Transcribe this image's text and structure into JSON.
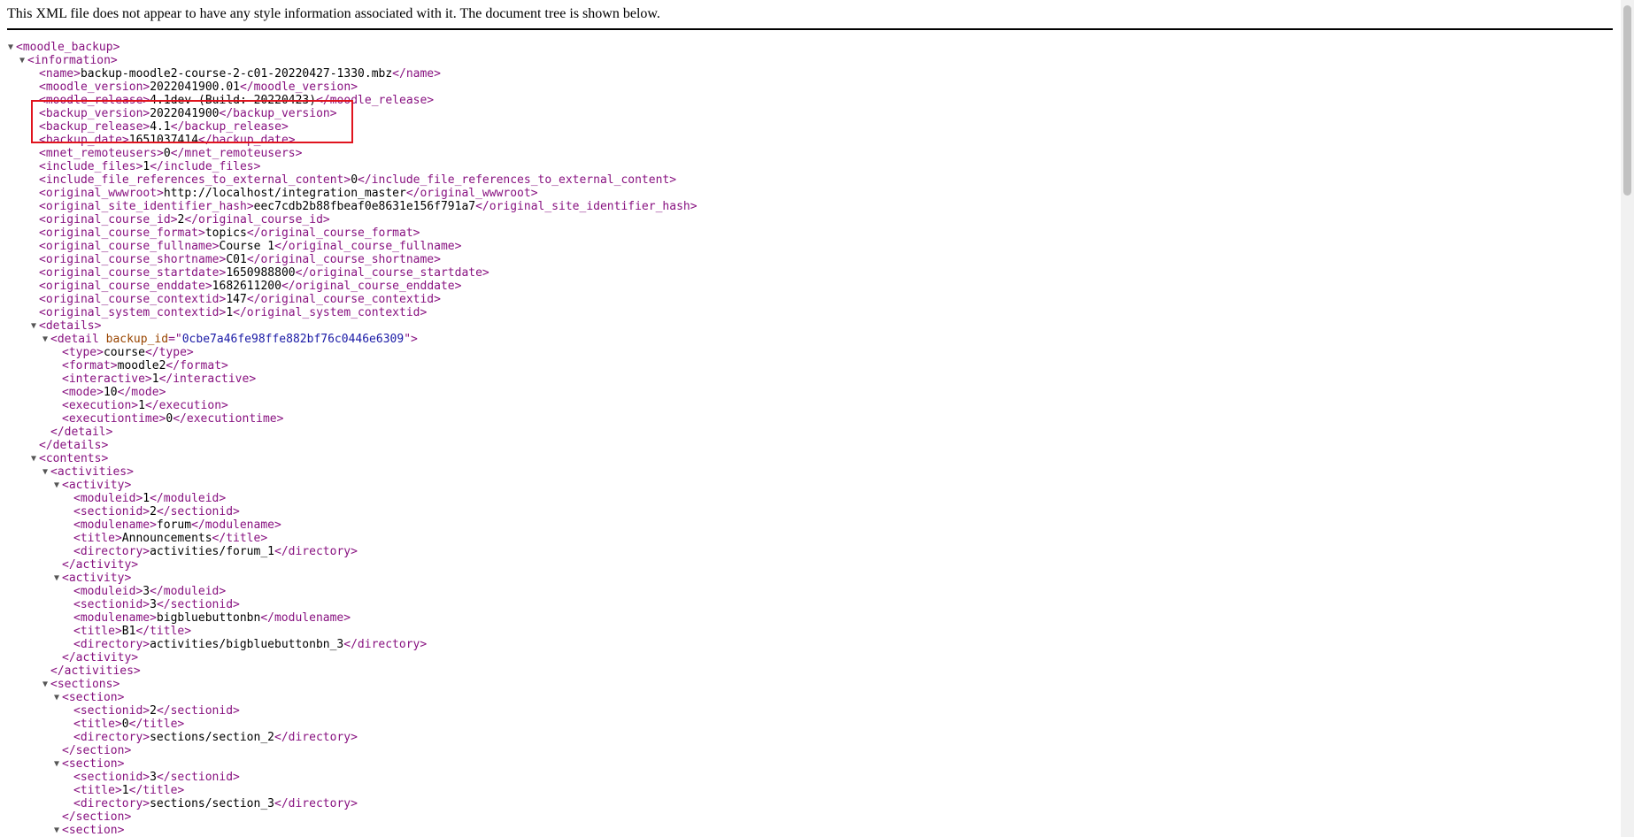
{
  "header": {
    "message": "This XML file does not appear to have any style information associated with it. The document tree is shown below."
  },
  "colors": {
    "tag": "#881280",
    "attr_name": "#994500",
    "attr_value": "#1a1aa6",
    "highlight": "#e0141e"
  },
  "lines": [
    {
      "indent": 0,
      "toggle": true,
      "open": "moodle_backup"
    },
    {
      "indent": 1,
      "toggle": true,
      "open": "information"
    },
    {
      "indent": 2,
      "open": "name",
      "text": "backup-moodle2-course-2-c01-20220427-1330.mbz",
      "close": "name"
    },
    {
      "indent": 2,
      "open": "moodle_version",
      "text": "2022041900.01",
      "close": "moodle_version"
    },
    {
      "indent": 2,
      "open": "moodle_release",
      "text": "4.1dev (Build: 20220423)",
      "close": "moodle_release"
    },
    {
      "indent": 2,
      "open": "backup_version",
      "text": "2022041900",
      "close": "backup_version"
    },
    {
      "indent": 2,
      "open": "backup_release",
      "text": "4.1",
      "close": "backup_release"
    },
    {
      "indent": 2,
      "open": "backup_date",
      "text": "1651037414",
      "close": "backup_date"
    },
    {
      "indent": 2,
      "open": "mnet_remoteusers",
      "text": "0",
      "close": "mnet_remoteusers"
    },
    {
      "indent": 2,
      "open": "include_files",
      "text": "1",
      "close": "include_files"
    },
    {
      "indent": 2,
      "open": "include_file_references_to_external_content",
      "text": "0",
      "close": "include_file_references_to_external_content"
    },
    {
      "indent": 2,
      "open": "original_wwwroot",
      "text": "http://localhost/integration_master",
      "close": "original_wwwroot"
    },
    {
      "indent": 2,
      "open": "original_site_identifier_hash",
      "text": "eec7cdb2b88fbeaf0e8631e156f791a7",
      "close": "original_site_identifier_hash"
    },
    {
      "indent": 2,
      "open": "original_course_id",
      "text": "2",
      "close": "original_course_id"
    },
    {
      "indent": 2,
      "open": "original_course_format",
      "text": "topics",
      "close": "original_course_format"
    },
    {
      "indent": 2,
      "open": "original_course_fullname",
      "text": "Course 1",
      "close": "original_course_fullname"
    },
    {
      "indent": 2,
      "open": "original_course_shortname",
      "text": "C01",
      "close": "original_course_shortname"
    },
    {
      "indent": 2,
      "open": "original_course_startdate",
      "text": "1650988800",
      "close": "original_course_startdate"
    },
    {
      "indent": 2,
      "open": "original_course_enddate",
      "text": "1682611200",
      "close": "original_course_enddate"
    },
    {
      "indent": 2,
      "open": "original_course_contextid",
      "text": "147",
      "close": "original_course_contextid"
    },
    {
      "indent": 2,
      "open": "original_system_contextid",
      "text": "1",
      "close": "original_system_contextid"
    },
    {
      "indent": 2,
      "toggle": true,
      "open": "details"
    },
    {
      "indent": 3,
      "toggle": true,
      "open": "detail",
      "attr": "backup_id",
      "attr_value": "0cbe7a46fe98ffe882bf76c0446e6309"
    },
    {
      "indent": 4,
      "open": "type",
      "text": "course",
      "close": "type"
    },
    {
      "indent": 4,
      "open": "format",
      "text": "moodle2",
      "close": "format"
    },
    {
      "indent": 4,
      "open": "interactive",
      "text": "1",
      "close": "interactive"
    },
    {
      "indent": 4,
      "open": "mode",
      "text": "10",
      "close": "mode"
    },
    {
      "indent": 4,
      "open": "execution",
      "text": "1",
      "close": "execution"
    },
    {
      "indent": 4,
      "open": "executiontime",
      "text": "0",
      "close": "executiontime"
    },
    {
      "indent": 3,
      "close": "detail"
    },
    {
      "indent": 2,
      "close": "details"
    },
    {
      "indent": 2,
      "toggle": true,
      "open": "contents"
    },
    {
      "indent": 3,
      "toggle": true,
      "open": "activities"
    },
    {
      "indent": 4,
      "toggle": true,
      "open": "activity"
    },
    {
      "indent": 5,
      "open": "moduleid",
      "text": "1",
      "close": "moduleid"
    },
    {
      "indent": 5,
      "open": "sectionid",
      "text": "2",
      "close": "sectionid"
    },
    {
      "indent": 5,
      "open": "modulename",
      "text": "forum",
      "close": "modulename"
    },
    {
      "indent": 5,
      "open": "title",
      "text": "Announcements",
      "close": "title"
    },
    {
      "indent": 5,
      "open": "directory",
      "text": "activities/forum_1",
      "close": "directory"
    },
    {
      "indent": 4,
      "close": "activity"
    },
    {
      "indent": 4,
      "toggle": true,
      "open": "activity"
    },
    {
      "indent": 5,
      "open": "moduleid",
      "text": "3",
      "close": "moduleid"
    },
    {
      "indent": 5,
      "open": "sectionid",
      "text": "3",
      "close": "sectionid"
    },
    {
      "indent": 5,
      "open": "modulename",
      "text": "bigbluebuttonbn",
      "close": "modulename"
    },
    {
      "indent": 5,
      "open": "title",
      "text": "B1",
      "close": "title"
    },
    {
      "indent": 5,
      "open": "directory",
      "text": "activities/bigbluebuttonbn_3",
      "close": "directory"
    },
    {
      "indent": 4,
      "close": "activity"
    },
    {
      "indent": 3,
      "close": "activities"
    },
    {
      "indent": 3,
      "toggle": true,
      "open": "sections"
    },
    {
      "indent": 4,
      "toggle": true,
      "open": "section"
    },
    {
      "indent": 5,
      "open": "sectionid",
      "text": "2",
      "close": "sectionid"
    },
    {
      "indent": 5,
      "open": "title",
      "text": "0",
      "close": "title"
    },
    {
      "indent": 5,
      "open": "directory",
      "text": "sections/section_2",
      "close": "directory"
    },
    {
      "indent": 4,
      "close": "section"
    },
    {
      "indent": 4,
      "toggle": true,
      "open": "section"
    },
    {
      "indent": 5,
      "open": "sectionid",
      "text": "3",
      "close": "sectionid"
    },
    {
      "indent": 5,
      "open": "title",
      "text": "1",
      "close": "title"
    },
    {
      "indent": 5,
      "open": "directory",
      "text": "sections/section_3",
      "close": "directory"
    },
    {
      "indent": 4,
      "close": "section"
    },
    {
      "indent": 4,
      "toggle": true,
      "open": "section"
    }
  ]
}
